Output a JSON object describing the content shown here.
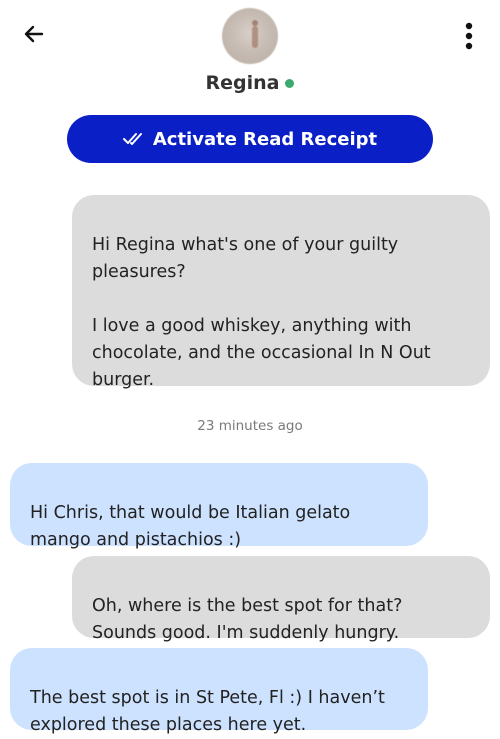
{
  "header": {
    "back_icon": "arrow-left-icon",
    "menu_icon": "more-vertical-icon",
    "contact_name": "Regina",
    "status": "online",
    "status_color": "#3aaa6e"
  },
  "read_receipt": {
    "label": "Activate Read Receipt",
    "icon": "double-check-icon",
    "color": "#0a1fc5"
  },
  "messages": [
    {
      "direction": "outgoing",
      "text": "Hi Regina what's one of your guilty pleasures?\n\nI love a good whiskey, anything with chocolate, and the occasional In N Out burger."
    },
    {
      "direction": "incoming",
      "text": "Hi Chris, that would be Italian gelato mango and pistachios :)"
    },
    {
      "direction": "outgoing",
      "text": "Oh, where is the best spot for that? Sounds good. I'm suddenly hungry."
    },
    {
      "direction": "incoming",
      "text": "The best spot is in St Pete, Fl :) I haven’t explored these places here yet."
    }
  ],
  "timestamp": "23 minutes ago",
  "colors": {
    "outgoing_bubble": "#dcdcdc",
    "incoming_bubble": "#cde2ff"
  }
}
